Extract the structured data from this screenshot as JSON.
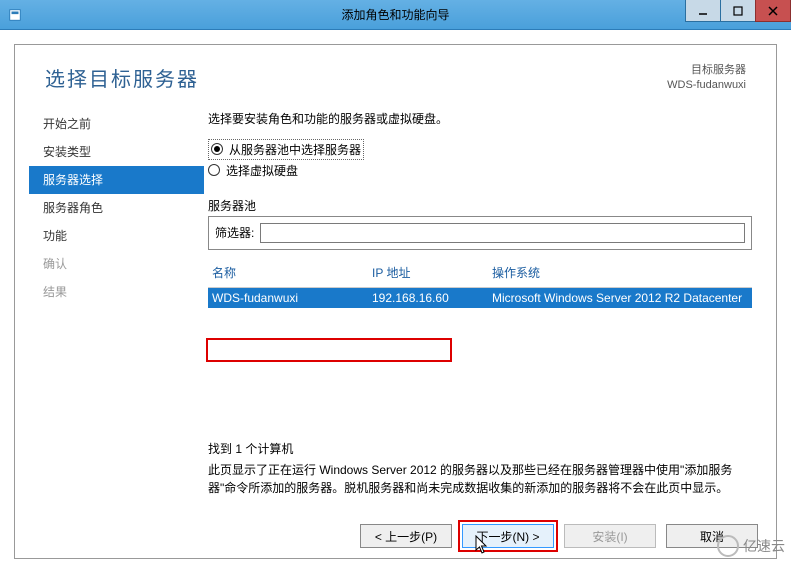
{
  "titlebar": {
    "title": "添加角色和功能向导"
  },
  "header": {
    "page_title": "选择目标服务器",
    "right_label": "目标服务器",
    "right_value": "WDS-fudanwuxi"
  },
  "sidebar": {
    "items": [
      {
        "label": "开始之前",
        "state": "normal"
      },
      {
        "label": "安装类型",
        "state": "normal"
      },
      {
        "label": "服务器选择",
        "state": "active"
      },
      {
        "label": "服务器角色",
        "state": "normal"
      },
      {
        "label": "功能",
        "state": "normal"
      },
      {
        "label": "确认",
        "state": "disabled"
      },
      {
        "label": "结果",
        "state": "disabled"
      }
    ]
  },
  "main": {
    "instruction": "选择要安装角色和功能的服务器或虚拟硬盘。",
    "radio1": "从服务器池中选择服务器",
    "radio2": "选择虚拟硬盘",
    "pool_label": "服务器池",
    "filter_label": "筛选器:",
    "filter_value": "",
    "columns": {
      "name": "名称",
      "ip": "IP 地址",
      "os": "操作系统"
    },
    "rows": [
      {
        "name": "WDS-fudanwuxi",
        "ip": "192.168.16.60",
        "os": "Microsoft Windows Server 2012 R2 Datacenter"
      }
    ],
    "found": "找到 1 个计算机",
    "description": "此页显示了正在运行 Windows Server 2012 的服务器以及那些已经在服务器管理器中使用\"添加服务器\"命令所添加的服务器。脱机服务器和尚未完成数据收集的新添加的服务器将不会在此页中显示。"
  },
  "footer": {
    "prev": "< 上一步(P)",
    "next": "下一步(N) >",
    "install": "安装(I)",
    "cancel": "取消"
  },
  "watermark": "亿速云"
}
